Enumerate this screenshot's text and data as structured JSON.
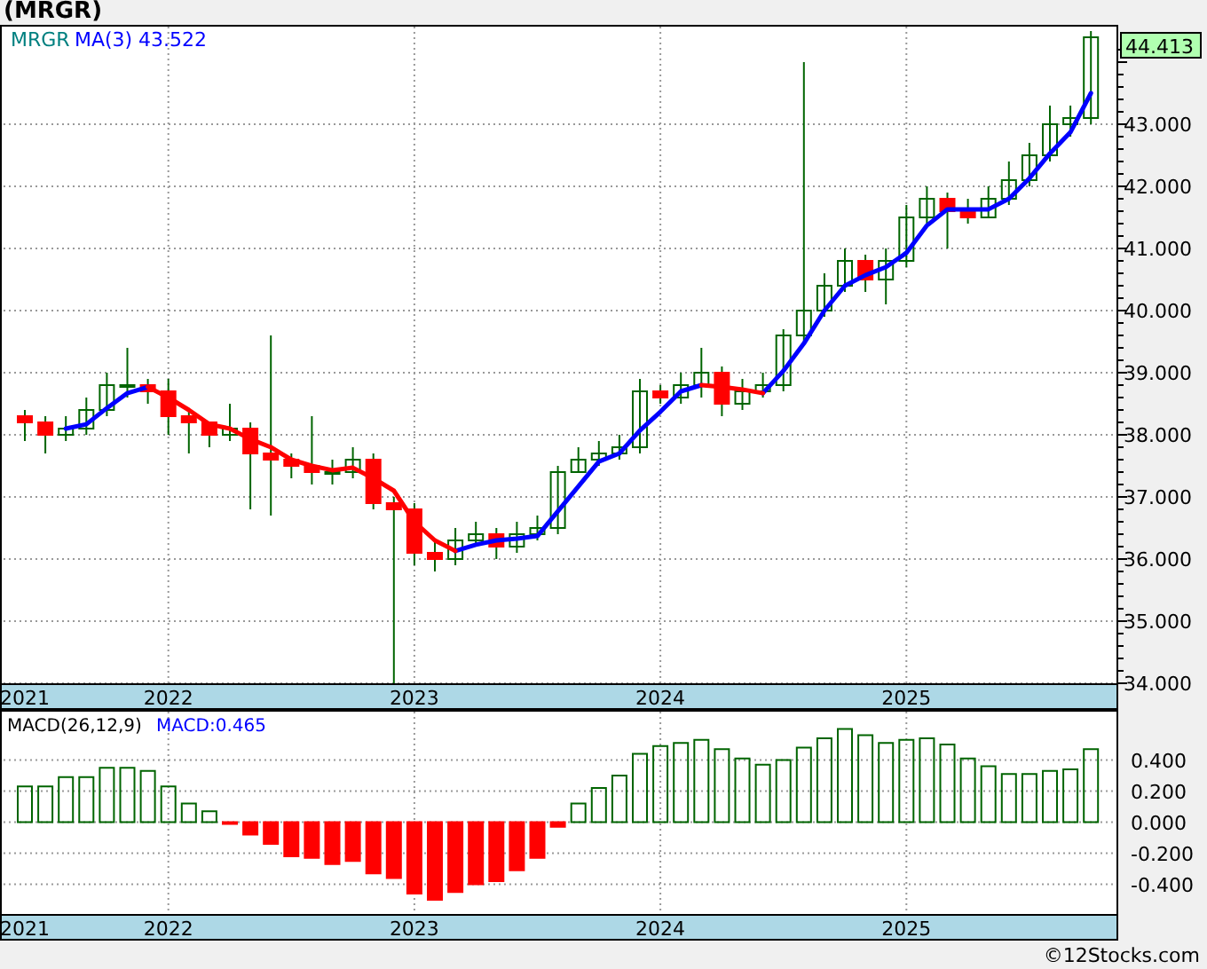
{
  "title": "(MRGR)",
  "price_chart": {
    "legend": {
      "symbol": "MRGR",
      "indicator_value": "43.522"
    },
    "last_price": "44.413",
    "chart_data": {
      "type": "candlestick",
      "grid": true,
      "categories": [
        "2021",
        null,
        null,
        null,
        null,
        null,
        null,
        "2022",
        null,
        null,
        null,
        null,
        null,
        null,
        null,
        null,
        null,
        null,
        null,
        "2023",
        null,
        null,
        null,
        null,
        null,
        null,
        null,
        null,
        null,
        null,
        null,
        "2024",
        null,
        null,
        null,
        null,
        null,
        null,
        null,
        null,
        null,
        null,
        null,
        "2025",
        null,
        null,
        null,
        null,
        null,
        null,
        null,
        null,
        null
      ],
      "yticks": [
        {
          "value": 34,
          "label": "34.000"
        },
        {
          "value": 35,
          "label": "35.000"
        },
        {
          "value": 36,
          "label": "36.000"
        },
        {
          "value": 37,
          "label": "37.000"
        },
        {
          "value": 38,
          "label": "38.000"
        },
        {
          "value": 39,
          "label": "39.000"
        },
        {
          "value": 40,
          "label": "40.000"
        },
        {
          "value": 41,
          "label": "41.000"
        },
        {
          "value": 42,
          "label": "42.000"
        },
        {
          "value": 43,
          "label": "43.000"
        }
      ],
      "ylim": [
        34,
        44.6
      ],
      "series": [
        {
          "name": "MA(3)",
          "type": "line",
          "color": "#0000ff",
          "values": [
            null,
            null,
            38.1,
            38.17,
            38.43,
            38.67,
            38.77,
            null,
            null,
            null,
            null,
            null,
            null,
            null,
            null,
            null,
            null,
            null,
            null,
            null,
            null,
            36.13,
            36.23,
            36.3,
            36.33,
            36.37,
            36.77,
            37.17,
            37.57,
            37.7,
            38.07,
            38.37,
            38.7,
            38.8,
            null,
            null,
            38.67,
            39.03,
            39.47,
            40.0,
            40.4,
            40.57,
            40.7,
            40.93,
            41.37,
            41.63,
            41.63,
            41.63,
            41.8,
            42.13,
            42.53,
            42.87,
            43.5
          ]
        },
        {
          "type": "line",
          "color": "#ff0000",
          "values": [
            null,
            null,
            null,
            null,
            null,
            null,
            38.77,
            38.6,
            38.4,
            38.17,
            38.1,
            37.93,
            37.8,
            37.6,
            37.5,
            37.43,
            37.47,
            37.3,
            37.1,
            36.6,
            36.3,
            36.13,
            null,
            null,
            null,
            null,
            null,
            null,
            null,
            null,
            null,
            null,
            null,
            38.8,
            38.77,
            38.73,
            38.67,
            null,
            null,
            null,
            null,
            null,
            null,
            null,
            null,
            null,
            null,
            null,
            null,
            null,
            null,
            null,
            null
          ]
        }
      ],
      "ohlc": [
        [
          38.3,
          38.4,
          37.9,
          38.2
        ],
        [
          38.2,
          38.3,
          37.7,
          38.0
        ],
        [
          38.0,
          38.3,
          37.9,
          38.1
        ],
        [
          38.1,
          38.6,
          38.0,
          38.4
        ],
        [
          38.4,
          39.0,
          38.3,
          38.8
        ],
        [
          38.8,
          39.4,
          38.6,
          38.8
        ],
        [
          38.8,
          38.9,
          38.5,
          38.7
        ],
        [
          38.7,
          38.9,
          38.0,
          38.3
        ],
        [
          38.3,
          38.4,
          37.7,
          38.2
        ],
        [
          38.2,
          38.2,
          37.8,
          38.0
        ],
        [
          38.0,
          38.5,
          37.9,
          38.1
        ],
        [
          38.1,
          38.2,
          36.8,
          37.7
        ],
        [
          37.7,
          39.6,
          36.7,
          37.6
        ],
        [
          37.6,
          37.7,
          37.3,
          37.5
        ],
        [
          37.5,
          38.3,
          37.2,
          37.4
        ],
        [
          37.4,
          37.6,
          37.2,
          37.4
        ],
        [
          37.4,
          37.8,
          37.3,
          37.6
        ],
        [
          37.6,
          37.7,
          36.8,
          36.9
        ],
        [
          36.9,
          37.0,
          34.0,
          36.8
        ],
        [
          36.8,
          36.9,
          35.9,
          36.1
        ],
        [
          36.1,
          36.3,
          35.8,
          36.0
        ],
        [
          36.0,
          36.5,
          35.9,
          36.3
        ],
        [
          36.3,
          36.6,
          36.2,
          36.4
        ],
        [
          36.4,
          36.5,
          36.0,
          36.2
        ],
        [
          36.2,
          36.6,
          36.1,
          36.4
        ],
        [
          36.4,
          36.7,
          36.3,
          36.5
        ],
        [
          36.5,
          37.5,
          36.4,
          37.4
        ],
        [
          37.4,
          37.8,
          37.4,
          37.6
        ],
        [
          37.6,
          37.9,
          37.5,
          37.7
        ],
        [
          37.7,
          38.0,
          37.6,
          37.8
        ],
        [
          37.8,
          38.9,
          37.7,
          38.7
        ],
        [
          38.7,
          38.8,
          38.5,
          38.6
        ],
        [
          38.6,
          39.0,
          38.5,
          38.8
        ],
        [
          38.8,
          39.4,
          38.6,
          39.0
        ],
        [
          39.0,
          39.1,
          38.3,
          38.5
        ],
        [
          38.5,
          38.9,
          38.4,
          38.7
        ],
        [
          38.7,
          39.0,
          38.6,
          38.8
        ],
        [
          38.8,
          39.7,
          38.7,
          39.6
        ],
        [
          39.6,
          44.0,
          39.5,
          40.0
        ],
        [
          40.0,
          40.6,
          39.9,
          40.4
        ],
        [
          40.4,
          41.0,
          40.3,
          40.8
        ],
        [
          40.8,
          40.9,
          40.3,
          40.5
        ],
        [
          40.5,
          41.0,
          40.1,
          40.8
        ],
        [
          40.8,
          41.7,
          40.7,
          41.5
        ],
        [
          41.5,
          42.0,
          41.4,
          41.8
        ],
        [
          41.8,
          41.9,
          41.0,
          41.6
        ],
        [
          41.6,
          41.8,
          41.4,
          41.5
        ],
        [
          41.5,
          42.0,
          41.5,
          41.8
        ],
        [
          41.8,
          42.4,
          41.7,
          42.1
        ],
        [
          42.1,
          42.7,
          42.0,
          42.5
        ],
        [
          42.5,
          43.3,
          42.4,
          43.0
        ],
        [
          43.0,
          43.3,
          42.8,
          43.1
        ],
        [
          43.1,
          44.5,
          43.0,
          44.4
        ]
      ]
    }
  },
  "macd_chart": {
    "legend_value": "MACD:0.465",
    "chart_data": {
      "type": "bar",
      "grid": true,
      "categories": [
        "2021",
        null,
        null,
        null,
        null,
        null,
        null,
        "2022",
        null,
        null,
        null,
        null,
        null,
        null,
        null,
        null,
        null,
        null,
        null,
        "2023",
        null,
        null,
        null,
        null,
        null,
        null,
        null,
        null,
        null,
        null,
        null,
        "2024",
        null,
        null,
        null,
        null,
        null,
        null,
        null,
        null,
        null,
        null,
        null,
        "2025",
        null,
        null,
        null,
        null,
        null,
        null,
        null,
        null,
        null
      ],
      "yticks": [
        {
          "value": -0.4,
          "label": "-0.400"
        },
        {
          "value": -0.2,
          "label": "-0.200"
        },
        {
          "value": 0,
          "label": "0.000"
        },
        {
          "value": 0.2,
          "label": "0.200"
        },
        {
          "value": 0.4,
          "label": "0.400"
        }
      ],
      "ylim": [
        -0.58,
        0.7
      ],
      "series": [
        {
          "name": "MACD(26,12,9)",
          "color": "#006400",
          "values": [
            0.23,
            0.23,
            0.29,
            0.29,
            0.35,
            0.35,
            0.33,
            0.23,
            0.12,
            0.07,
            null,
            null,
            null,
            null,
            null,
            null,
            null,
            null,
            null,
            null,
            null,
            null,
            null,
            null,
            null,
            null,
            null,
            0.12,
            0.22,
            0.3,
            0.44,
            0.49,
            0.51,
            0.53,
            0.47,
            0.41,
            0.37,
            0.4,
            0.48,
            0.54,
            0.6,
            0.56,
            0.51,
            0.53,
            0.54,
            0.5,
            0.41,
            0.36,
            0.31,
            0.31,
            0.33,
            0.34,
            0.47
          ]
        },
        {
          "color": "#ff0000",
          "values": [
            null,
            null,
            null,
            null,
            null,
            null,
            null,
            null,
            null,
            null,
            -0.01,
            -0.08,
            -0.14,
            -0.22,
            -0.23,
            -0.27,
            -0.25,
            -0.33,
            -0.36,
            -0.46,
            -0.5,
            -0.45,
            -0.4,
            -0.38,
            -0.31,
            -0.23,
            -0.03,
            null,
            null,
            null,
            null,
            null,
            null,
            null,
            null,
            null,
            null,
            null,
            null,
            null,
            null,
            null,
            null,
            null,
            null,
            null,
            null,
            null,
            null,
            null,
            null,
            null,
            null
          ]
        }
      ]
    }
  },
  "credit": "©12Stocks.com"
}
